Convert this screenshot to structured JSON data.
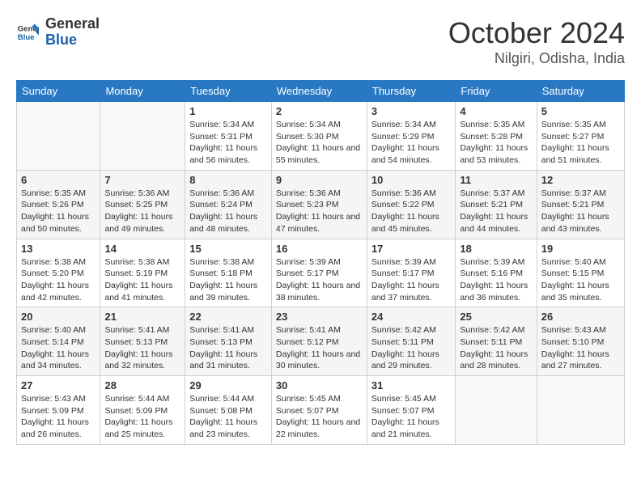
{
  "header": {
    "logo_general": "General",
    "logo_blue": "Blue",
    "month_title": "October 2024",
    "location": "Nilgiri, Odisha, India"
  },
  "calendar": {
    "days_of_week": [
      "Sunday",
      "Monday",
      "Tuesday",
      "Wednesday",
      "Thursday",
      "Friday",
      "Saturday"
    ],
    "weeks": [
      [
        {
          "day": "",
          "info": ""
        },
        {
          "day": "",
          "info": ""
        },
        {
          "day": "1",
          "info": "Sunrise: 5:34 AM\nSunset: 5:31 PM\nDaylight: 11 hours and 56 minutes."
        },
        {
          "day": "2",
          "info": "Sunrise: 5:34 AM\nSunset: 5:30 PM\nDaylight: 11 hours and 55 minutes."
        },
        {
          "day": "3",
          "info": "Sunrise: 5:34 AM\nSunset: 5:29 PM\nDaylight: 11 hours and 54 minutes."
        },
        {
          "day": "4",
          "info": "Sunrise: 5:35 AM\nSunset: 5:28 PM\nDaylight: 11 hours and 53 minutes."
        },
        {
          "day": "5",
          "info": "Sunrise: 5:35 AM\nSunset: 5:27 PM\nDaylight: 11 hours and 51 minutes."
        }
      ],
      [
        {
          "day": "6",
          "info": "Sunrise: 5:35 AM\nSunset: 5:26 PM\nDaylight: 11 hours and 50 minutes."
        },
        {
          "day": "7",
          "info": "Sunrise: 5:36 AM\nSunset: 5:25 PM\nDaylight: 11 hours and 49 minutes."
        },
        {
          "day": "8",
          "info": "Sunrise: 5:36 AM\nSunset: 5:24 PM\nDaylight: 11 hours and 48 minutes."
        },
        {
          "day": "9",
          "info": "Sunrise: 5:36 AM\nSunset: 5:23 PM\nDaylight: 11 hours and 47 minutes."
        },
        {
          "day": "10",
          "info": "Sunrise: 5:36 AM\nSunset: 5:22 PM\nDaylight: 11 hours and 45 minutes."
        },
        {
          "day": "11",
          "info": "Sunrise: 5:37 AM\nSunset: 5:21 PM\nDaylight: 11 hours and 44 minutes."
        },
        {
          "day": "12",
          "info": "Sunrise: 5:37 AM\nSunset: 5:21 PM\nDaylight: 11 hours and 43 minutes."
        }
      ],
      [
        {
          "day": "13",
          "info": "Sunrise: 5:38 AM\nSunset: 5:20 PM\nDaylight: 11 hours and 42 minutes."
        },
        {
          "day": "14",
          "info": "Sunrise: 5:38 AM\nSunset: 5:19 PM\nDaylight: 11 hours and 41 minutes."
        },
        {
          "day": "15",
          "info": "Sunrise: 5:38 AM\nSunset: 5:18 PM\nDaylight: 11 hours and 39 minutes."
        },
        {
          "day": "16",
          "info": "Sunrise: 5:39 AM\nSunset: 5:17 PM\nDaylight: 11 hours and 38 minutes."
        },
        {
          "day": "17",
          "info": "Sunrise: 5:39 AM\nSunset: 5:17 PM\nDaylight: 11 hours and 37 minutes."
        },
        {
          "day": "18",
          "info": "Sunrise: 5:39 AM\nSunset: 5:16 PM\nDaylight: 11 hours and 36 minutes."
        },
        {
          "day": "19",
          "info": "Sunrise: 5:40 AM\nSunset: 5:15 PM\nDaylight: 11 hours and 35 minutes."
        }
      ],
      [
        {
          "day": "20",
          "info": "Sunrise: 5:40 AM\nSunset: 5:14 PM\nDaylight: 11 hours and 34 minutes."
        },
        {
          "day": "21",
          "info": "Sunrise: 5:41 AM\nSunset: 5:13 PM\nDaylight: 11 hours and 32 minutes."
        },
        {
          "day": "22",
          "info": "Sunrise: 5:41 AM\nSunset: 5:13 PM\nDaylight: 11 hours and 31 minutes."
        },
        {
          "day": "23",
          "info": "Sunrise: 5:41 AM\nSunset: 5:12 PM\nDaylight: 11 hours and 30 minutes."
        },
        {
          "day": "24",
          "info": "Sunrise: 5:42 AM\nSunset: 5:11 PM\nDaylight: 11 hours and 29 minutes."
        },
        {
          "day": "25",
          "info": "Sunrise: 5:42 AM\nSunset: 5:11 PM\nDaylight: 11 hours and 28 minutes."
        },
        {
          "day": "26",
          "info": "Sunrise: 5:43 AM\nSunset: 5:10 PM\nDaylight: 11 hours and 27 minutes."
        }
      ],
      [
        {
          "day": "27",
          "info": "Sunrise: 5:43 AM\nSunset: 5:09 PM\nDaylight: 11 hours and 26 minutes."
        },
        {
          "day": "28",
          "info": "Sunrise: 5:44 AM\nSunset: 5:09 PM\nDaylight: 11 hours and 25 minutes."
        },
        {
          "day": "29",
          "info": "Sunrise: 5:44 AM\nSunset: 5:08 PM\nDaylight: 11 hours and 23 minutes."
        },
        {
          "day": "30",
          "info": "Sunrise: 5:45 AM\nSunset: 5:07 PM\nDaylight: 11 hours and 22 minutes."
        },
        {
          "day": "31",
          "info": "Sunrise: 5:45 AM\nSunset: 5:07 PM\nDaylight: 11 hours and 21 minutes."
        },
        {
          "day": "",
          "info": ""
        },
        {
          "day": "",
          "info": ""
        }
      ]
    ]
  }
}
